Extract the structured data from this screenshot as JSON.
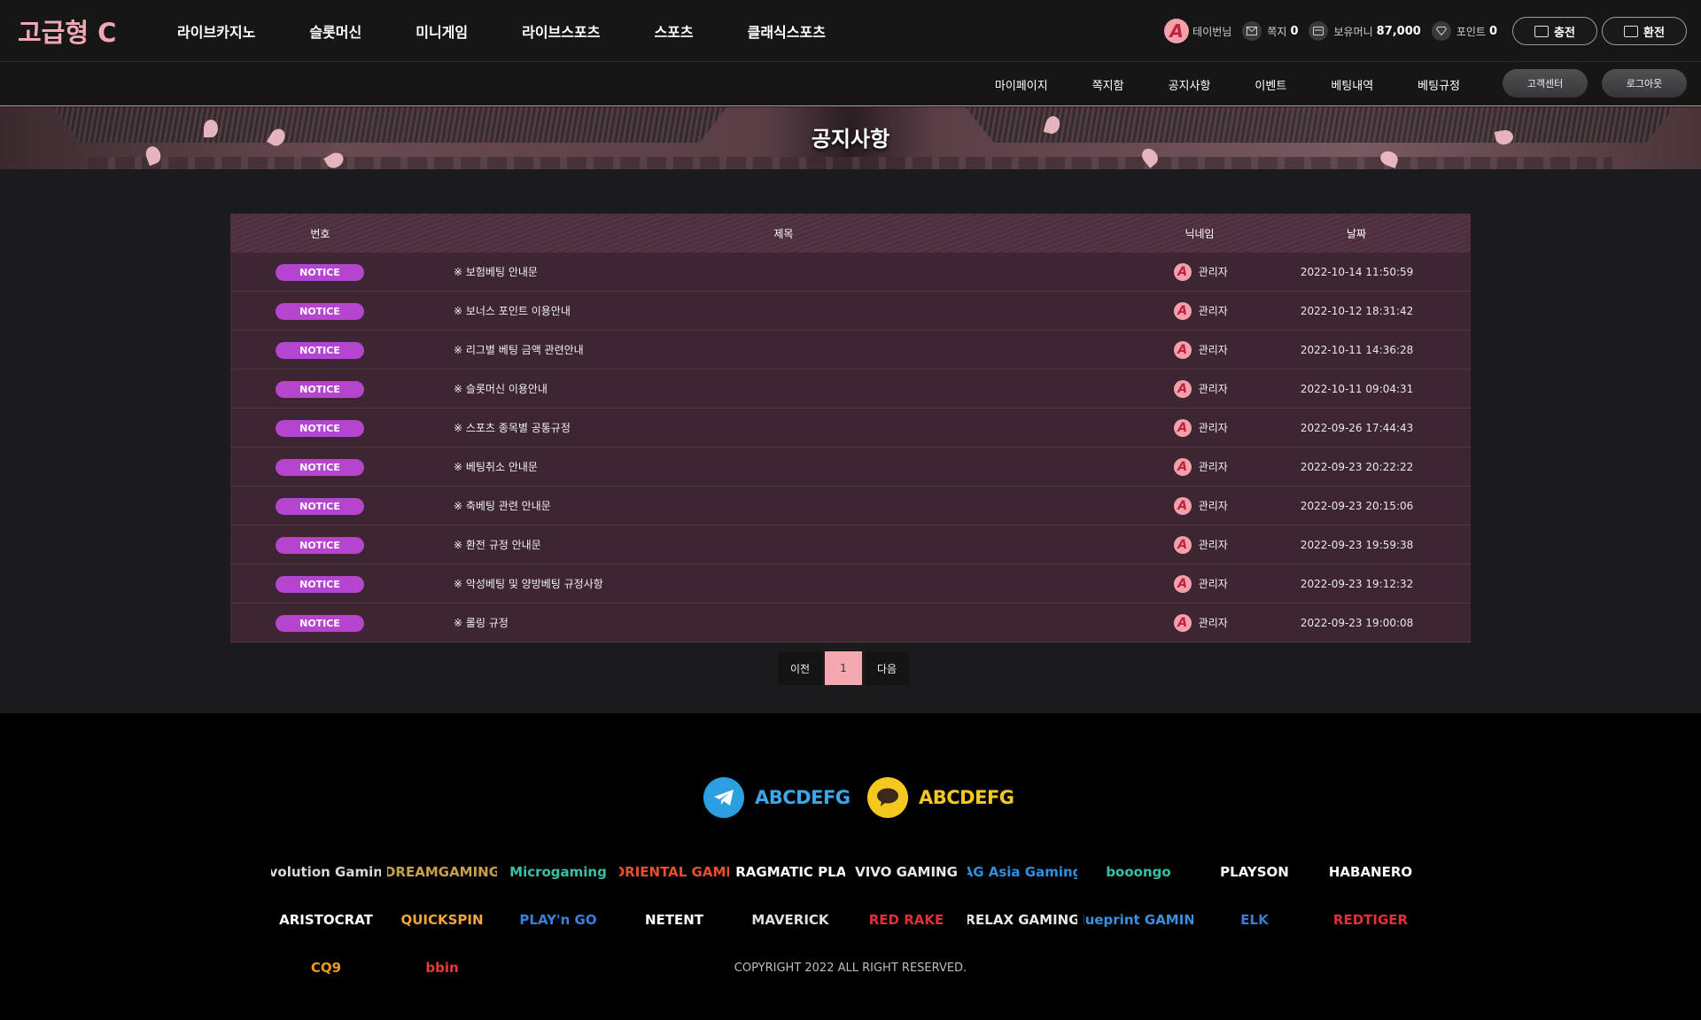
{
  "brand": {
    "logo_text": "고급형 C"
  },
  "main_nav": [
    "라이브카지노",
    "슬롯머신",
    "미니게임",
    "라이브스포츠",
    "스포츠",
    "클래식스포츠"
  ],
  "user": {
    "avatar_letter": "A",
    "name": "테이번님",
    "message_label": "쪽지",
    "message_count": "0",
    "money_label": "보유머니",
    "money_value": "87,000",
    "point_label": "포인트",
    "point_value": "0",
    "deposit_label": "충전",
    "withdraw_label": "환전"
  },
  "sub_nav": [
    "마이페이지",
    "쪽지함",
    "공지사항",
    "이벤트",
    "베팅내역",
    "베팅규정"
  ],
  "sub_buttons": {
    "support_label": "고객센터",
    "logout_label": "로그아웃"
  },
  "banner": {
    "title": "공지사항"
  },
  "board": {
    "columns": {
      "num": "번호",
      "title": "제목",
      "nickname": "닉네임",
      "date": "날짜"
    },
    "rows": [
      {
        "badge": "NOTICE",
        "title": "※ 보험베팅 안내문",
        "nickname": "관리자",
        "date": "2022-10-14 11:50:59"
      },
      {
        "badge": "NOTICE",
        "title": "※ 보너스 포인트 이용안내",
        "nickname": "관리자",
        "date": "2022-10-12 18:31:42"
      },
      {
        "badge": "NOTICE",
        "title": "※ 리그별 베팅 금액 관련안내",
        "nickname": "관리자",
        "date": "2022-10-11 14:36:28"
      },
      {
        "badge": "NOTICE",
        "title": "※ 슬롯머신 이용안내",
        "nickname": "관리자",
        "date": "2022-10-11 09:04:31"
      },
      {
        "badge": "NOTICE",
        "title": "※ 스포츠 종목별 공통규정",
        "nickname": "관리자",
        "date": "2022-09-26 17:44:43"
      },
      {
        "badge": "NOTICE",
        "title": "※ 베팅취소 안내문",
        "nickname": "관리자",
        "date": "2022-09-23 20:22:22"
      },
      {
        "badge": "NOTICE",
        "title": "※ 축베팅 관련 안내문",
        "nickname": "관리자",
        "date": "2022-09-23 20:15:06"
      },
      {
        "badge": "NOTICE",
        "title": "※ 환전 규정 안내문",
        "nickname": "관리자",
        "date": "2022-09-23 19:59:38"
      },
      {
        "badge": "NOTICE",
        "title": "※ 악성베팅 및 양방베팅 규정사항",
        "nickname": "관리자",
        "date": "2022-09-23 19:12:32"
      },
      {
        "badge": "NOTICE",
        "title": "※ 롤링 규정",
        "nickname": "관리자",
        "date": "2022-09-23 19:00:08"
      }
    ]
  },
  "pagination": {
    "prev_label": "이전",
    "current_page": "1",
    "next_label": "다음"
  },
  "footer": {
    "telegram_id": "ABCDEFG",
    "kakao_id": "ABCDEFG",
    "providers": [
      {
        "name": "Evolution Gaming",
        "color": "#d8d8d8"
      },
      {
        "name": "DREAMGAMING",
        "color": "#c9a04a"
      },
      {
        "name": "Microgaming",
        "color": "#3bbfa4"
      },
      {
        "name": "ORIENTAL GAME",
        "color": "#e8502a"
      },
      {
        "name": "PRAGMATIC PLAY",
        "color": "#ffffff"
      },
      {
        "name": "VIVO GAMING",
        "color": "#e8e8e8"
      },
      {
        "name": "AG Asia Gaming",
        "color": "#2f8fe0"
      },
      {
        "name": "booongo",
        "color": "#35c0a8"
      },
      {
        "name": "PLAYSON",
        "color": "#ffffff"
      },
      {
        "name": "HABANERO",
        "color": "#ffffff"
      },
      {
        "name": "ARISTOCRAT",
        "color": "#ffffff"
      },
      {
        "name": "QUICKSPIN",
        "color": "#f3a43a"
      },
      {
        "name": "PLAY'n GO",
        "color": "#3a7fe0"
      },
      {
        "name": "NETENT",
        "color": "#ffffff"
      },
      {
        "name": "MAVERICK",
        "color": "#e0e0e0"
      },
      {
        "name": "RED RAKE",
        "color": "#e0303a"
      },
      {
        "name": "RELAX GAMING",
        "color": "#e8e8e8"
      },
      {
        "name": "blueprint GAMING",
        "color": "#3a8fe0"
      },
      {
        "name": "ELK",
        "color": "#3a7ad8"
      },
      {
        "name": "REDTIGER",
        "color": "#e0303a"
      },
      {
        "name": "CQ9",
        "color": "#f09a1a"
      },
      {
        "name": "bbin",
        "color": "#e83a3a"
      }
    ],
    "copyright": "COPYRIGHT 2022  ALL RIGHT RESERVED."
  }
}
